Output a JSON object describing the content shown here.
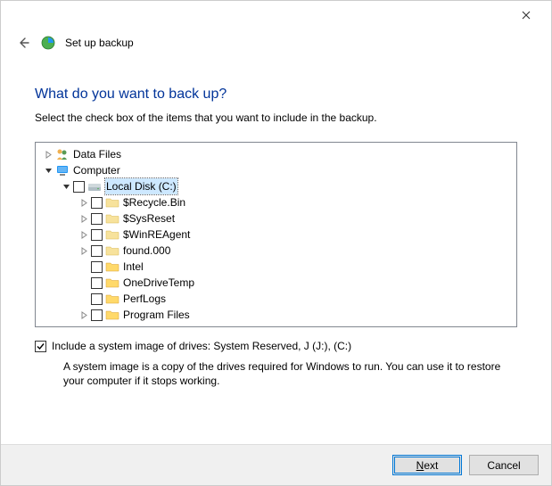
{
  "window": {
    "title": "Set up backup"
  },
  "heading": "What do you want to back up?",
  "instruction": "Select the check box of the items that you want to include in the backup.",
  "tree": {
    "data_files": "Data Files",
    "computer": "Computer",
    "local_disk": "Local Disk (C:)",
    "items": {
      "recycle": "$Recycle.Bin",
      "sysreset": "$SysReset",
      "winre": "$WinREAgent",
      "found": "found.000",
      "intel": "Intel",
      "onedrive": "OneDriveTemp",
      "perflogs": "PerfLogs",
      "progfiles": "Program Files"
    }
  },
  "system_image": {
    "label": "Include a system image of drives: System Reserved, J (J:), (C:)",
    "checked": true,
    "hint": "A system image is a copy of the drives required for Windows to run. You can use it to restore your computer if it stops working."
  },
  "buttons": {
    "next_first": "N",
    "next_rest": "ext",
    "cancel": "Cancel"
  }
}
